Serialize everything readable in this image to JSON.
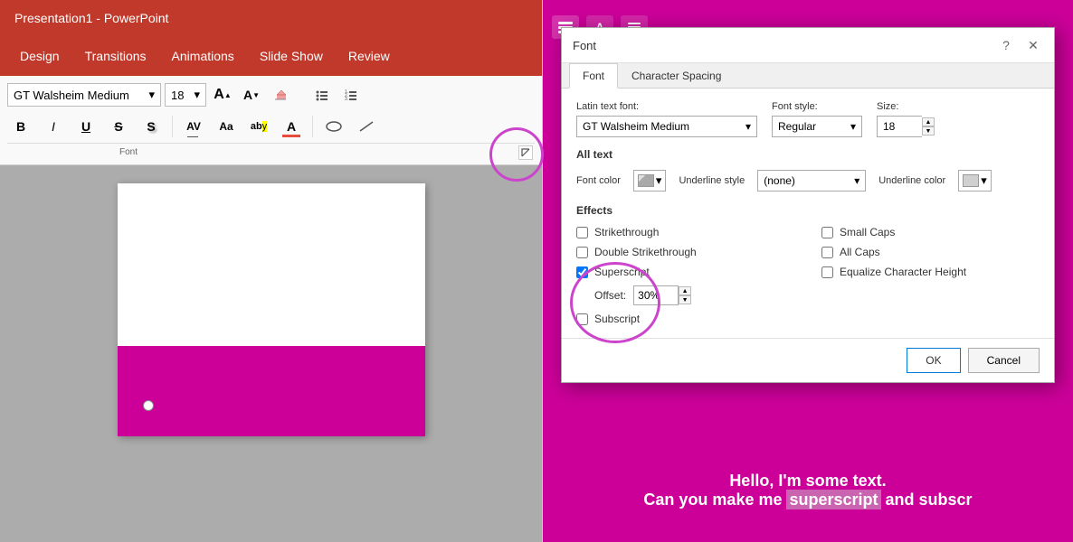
{
  "title_bar": {
    "text": "Presentation1  -  PowerPoint"
  },
  "menu_bar": {
    "items": [
      "Design",
      "Transitions",
      "Animations",
      "Slide Show",
      "Review"
    ]
  },
  "ribbon": {
    "font_name": "GT Walsheim Medium",
    "font_size": "18",
    "font_section_label": "Font",
    "buttons_row1": {
      "increase_font": "A",
      "decrease_font": "A",
      "clear_format": "🧹"
    },
    "format_buttons": {
      "bold": "B",
      "italic": "I",
      "underline": "U",
      "strikethrough": "S",
      "shadow": "S",
      "font_color": "A",
      "av_label": "AV",
      "aa_label": "Aa",
      "ab_label": "ab",
      "a_color": "A"
    }
  },
  "font_dialog": {
    "title": "Font",
    "question_btn": "?",
    "close_btn": "✕",
    "tabs": [
      "Font",
      "Character Spacing"
    ],
    "active_tab": "Font",
    "latin_text_font_label": "Latin text font:",
    "latin_text_font_value": "GT Walsheim Medium",
    "font_style_label": "Font style:",
    "font_style_value": "Regular",
    "size_label": "Size:",
    "size_value": "18",
    "all_text_label": "All text",
    "font_color_label": "Font color",
    "underline_style_label": "Underline style",
    "underline_style_value": "(none)",
    "underline_color_label": "Underline color",
    "effects_label": "Effects",
    "effects": {
      "strikethrough_label": "Strikethrough",
      "strikethrough_checked": false,
      "double_strikethrough_label": "Double Strikethrough",
      "double_strikethrough_checked": false,
      "superscript_label": "Superscript",
      "superscript_checked": true,
      "subscript_label": "Subscript",
      "subscript_checked": false,
      "small_caps_label": "Small Caps",
      "small_caps_checked": false,
      "all_caps_label": "All Caps",
      "all_caps_checked": false,
      "equalize_label": "Equalize Character Height",
      "equalize_checked": false
    },
    "offset_label": "Offset:",
    "offset_value": "30%",
    "ok_label": "OK",
    "cancel_label": "Cancel"
  },
  "slide_text": {
    "line1": "Hello, I'm some text.",
    "line2_start": "Can you make me ",
    "line2_highlight": "superscript",
    "line2_end": " and subscr"
  },
  "icons": {
    "dropdown_arrow": "▾",
    "spinner_up": "▲",
    "spinner_down": "▼",
    "expand": "↗"
  }
}
